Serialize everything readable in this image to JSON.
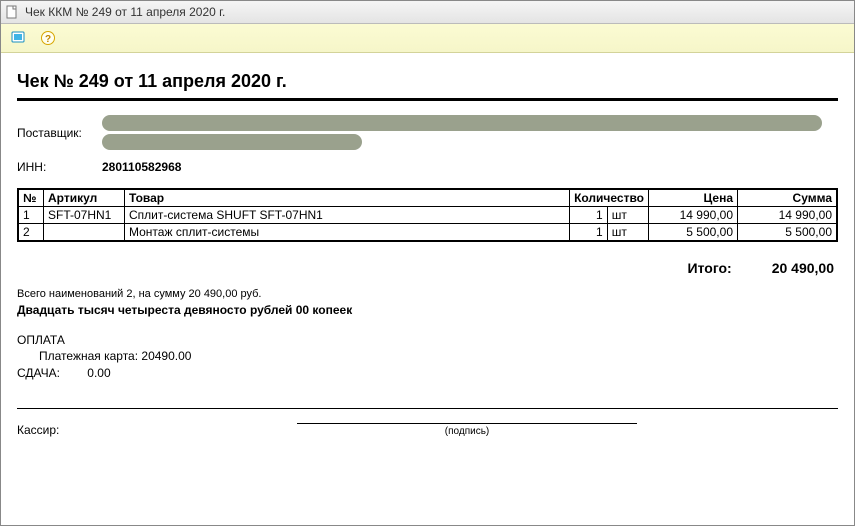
{
  "window": {
    "title": "Чек ККМ № 249 от 11 апреля 2020 г."
  },
  "document": {
    "title": "Чек № 249 от 11 апреля 2020 г.",
    "supplier_label": "Поставщик:",
    "inn_label": "ИНН:",
    "inn_value": "280110582968"
  },
  "table": {
    "headers": {
      "n": "№",
      "article": "Артикул",
      "name": "Товар",
      "qty": "Количество",
      "price": "Цена",
      "sum": "Сумма"
    },
    "rows": [
      {
        "n": "1",
        "article": "SFT-07HN1",
        "name": "Сплит-система SHUFT SFT-07HN1",
        "qty": "1",
        "unit": "шт",
        "price": "14 990,00",
        "sum": "14 990,00"
      },
      {
        "n": "2",
        "article": "",
        "name": "Монтаж сплит-системы",
        "qty": "1",
        "unit": "шт",
        "price": "5 500,00",
        "sum": "5 500,00"
      }
    ]
  },
  "totals": {
    "label": "Итого:",
    "value": "20 490,00",
    "summary": "Всего наименований 2, на сумму 20 490,00 руб.",
    "in_words": "Двадцать тысяч четыреста девяносто рублей 00 копеек"
  },
  "payment": {
    "header": "ОПЛАТА",
    "line": "Платежная карта: 20490.00",
    "change_label": "СДАЧА:",
    "change_value": "0.00"
  },
  "signature": {
    "cashier_label": "Кассир:",
    "caption": "(подпись)"
  }
}
